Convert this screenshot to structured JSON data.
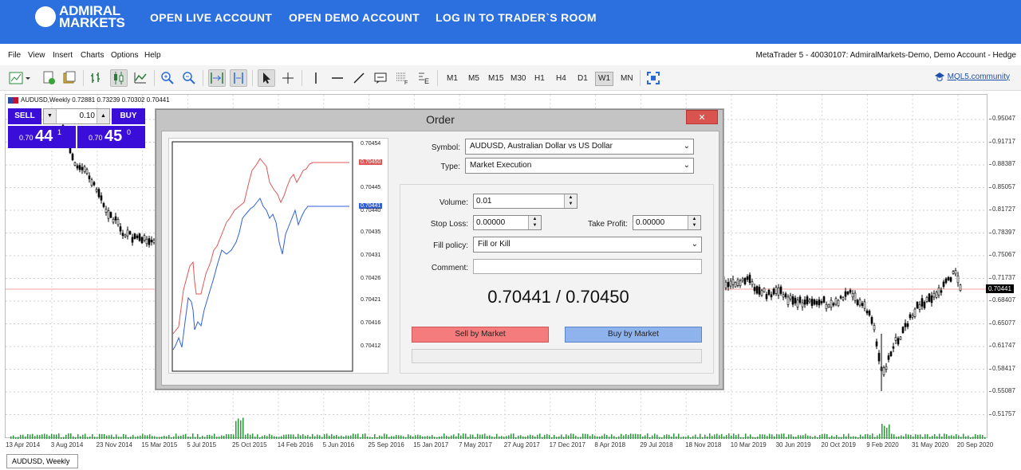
{
  "banner": {
    "logo_line1": "ADMIRAL",
    "logo_line2": "MARKETS",
    "links": [
      "OPEN LIVE ACCOUNT",
      "OPEN DEMO ACCOUNT",
      "LOG IN TO TRADER`S ROOM"
    ]
  },
  "menu": {
    "items": [
      "File",
      "View",
      "Insert",
      "Charts",
      "Options",
      "Help"
    ],
    "terminal_title": "MetaTrader 5 - 40030107: AdmiralMarkets-Demo, Demo Account - Hedge"
  },
  "toolbar": {
    "timeframes": [
      "M1",
      "M5",
      "M15",
      "M30",
      "H1",
      "H4",
      "D1",
      "W1",
      "MN"
    ],
    "active_timeframe": "W1",
    "mql_link": "MQL5.community"
  },
  "chart": {
    "header": "AUDUSD,Weekly  0.72881 0.73239 0.70302 0.70441",
    "current_price": "0.70441",
    "y_ticks": [
      "0.95047",
      "0.91717",
      "0.88387",
      "0.85057",
      "0.81727",
      "0.78397",
      "0.75067",
      "0.71737",
      "0.68407",
      "0.65077",
      "0.61747",
      "0.58417",
      "0.55087",
      "0.51757"
    ],
    "x_ticks": [
      "13 Apr 2014",
      "3 Aug 2014",
      "23 Nov 2014",
      "15 Mar 2015",
      "5 Jul 2015",
      "25 Oct 2015",
      "14 Feb 2016",
      "5 Jun 2016",
      "25 Sep 2016",
      "15 Jan 2017",
      "7 May 2017",
      "27 Aug 2017",
      "17 Dec 2017",
      "8 Apr 2018",
      "29 Jul 2018",
      "18 Nov 2018",
      "10 Mar 2019",
      "30 Jun 2019",
      "20 Oct 2019",
      "9 Feb 2020",
      "31 May 2020",
      "20 Sep 2020"
    ],
    "tab_label": "AUDUSD, Weekly"
  },
  "one_click": {
    "sell_label": "SELL",
    "buy_label": "BUY",
    "volume": "0.10",
    "sell_small": "0.70",
    "sell_big": "44",
    "sell_sup": "1",
    "buy_small": "0.70",
    "buy_big": "45",
    "buy_sup": "0"
  },
  "order": {
    "title": "Order",
    "close_label": "✕",
    "symbol_label": "Symbol:",
    "symbol_value": "AUDUSD, Australian Dollar vs US Dollar",
    "type_label": "Type:",
    "type_value": "Market Execution",
    "volume_label": "Volume:",
    "volume_value": "0.01",
    "stop_loss_label": "Stop Loss:",
    "stop_loss_value": "0.00000",
    "take_profit_label": "Take Profit:",
    "take_profit_value": "0.00000",
    "fill_policy_label": "Fill policy:",
    "fill_policy_value": "Fill or Kill",
    "comment_label": "Comment:",
    "comment_value": "",
    "quote": "0.70441 / 0.70450",
    "sell_button": "Sell by Market",
    "buy_button": "Buy by Market",
    "tick_labels": [
      "0.70454",
      "0.70450",
      "0.70445",
      "0.70440",
      "0.70435",
      "0.70431",
      "0.70426",
      "0.70421",
      "0.70416",
      "0.70412"
    ],
    "ask_tag": "0.70450",
    "bid_tag": "0.70441"
  },
  "colors": {
    "banner": "#2c6fdf",
    "one_click": "#3b0dd8",
    "ask_line": "#e05555",
    "bid_line": "#2f5fd8"
  }
}
